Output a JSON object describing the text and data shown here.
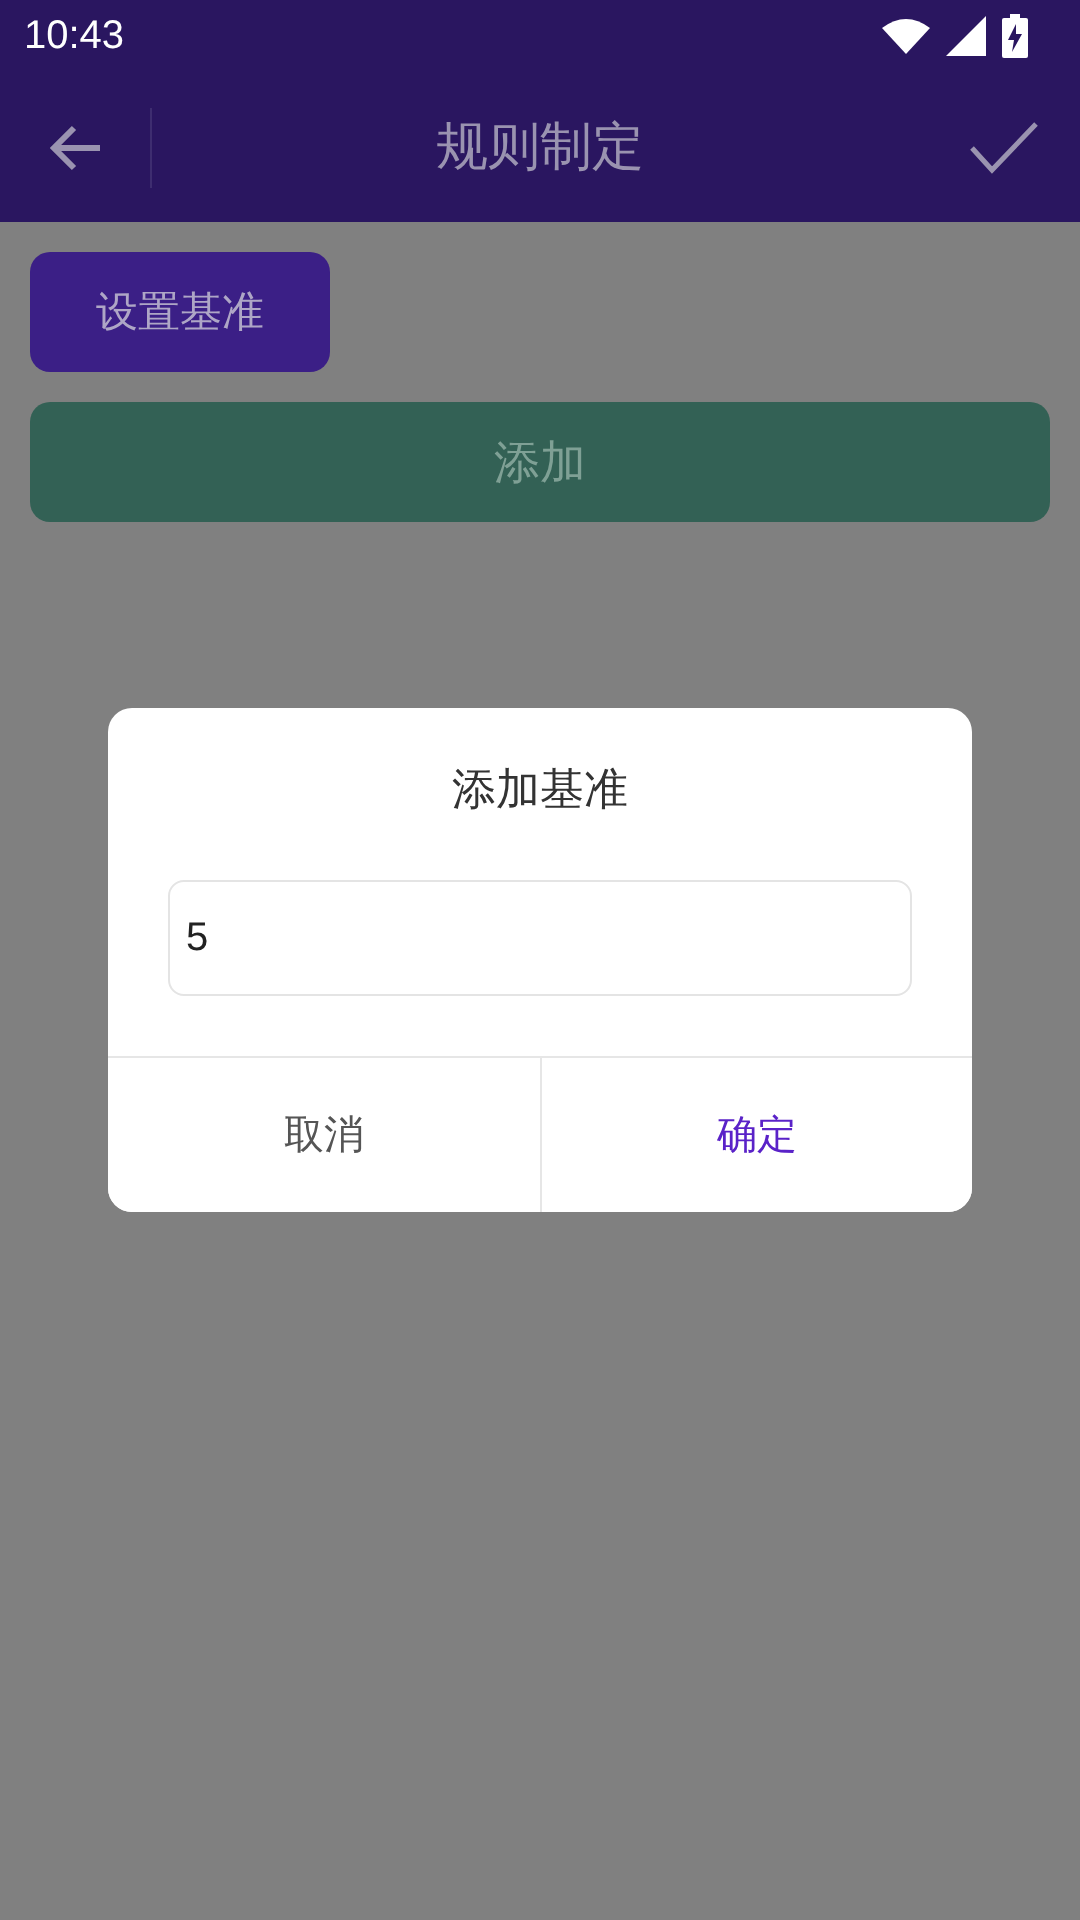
{
  "status_bar": {
    "time": "10:43"
  },
  "header": {
    "title": "规则制定"
  },
  "actions": [
    {
      "label": "设置基准",
      "kind": "chip"
    },
    {
      "label": "添加",
      "kind": "wide"
    }
  ],
  "dialog": {
    "title": "添加基准",
    "input": {
      "value": "5"
    },
    "buttons": [
      {
        "label": "取消",
        "kind": "cancel"
      },
      {
        "label": "确定",
        "kind": "confirm"
      }
    ]
  }
}
